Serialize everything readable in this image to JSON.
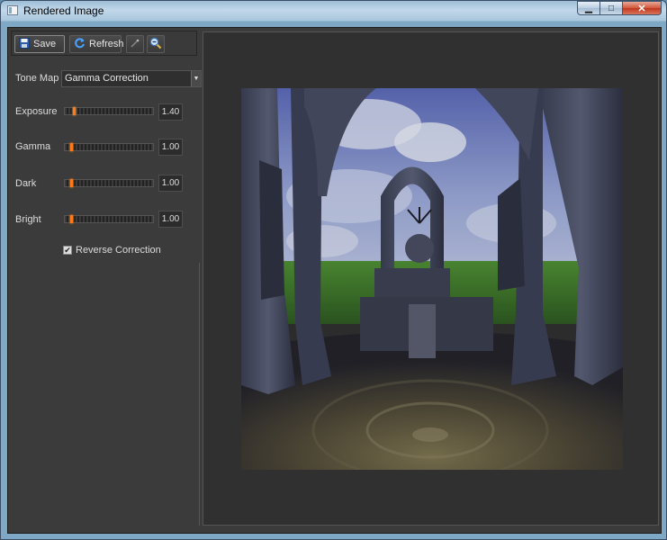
{
  "window": {
    "title": "Rendered Image",
    "minimize_glyph": "▁",
    "maximize_glyph": "□",
    "close_glyph": "✕"
  },
  "toolbar": {
    "save_label": "Save",
    "refresh_label": "Refresh",
    "icons": [
      "save-icon",
      "refresh-icon",
      "magic-wand-icon",
      "zoom-out-icon"
    ]
  },
  "tone_map": {
    "label": "Tone Map",
    "selected": "Gamma Correction"
  },
  "sliders": [
    {
      "label": "Exposure",
      "value": "1.40",
      "position": 0.09
    },
    {
      "label": "Gamma",
      "value": "1.00",
      "position": 0.06
    },
    {
      "label": "Dark",
      "value": "1.00",
      "position": 0.06
    },
    {
      "label": "Bright",
      "value": "1.00",
      "position": 0.06
    }
  ],
  "reverse_correction": {
    "label": "Reverse Correction",
    "checked": true,
    "check_glyph": "✔"
  },
  "colors": {
    "panel_bg": "#3b3b3b",
    "slider_thumb": "#ff7a1a",
    "sky": "#8f9fd0",
    "grass": "#3d7a2a"
  }
}
